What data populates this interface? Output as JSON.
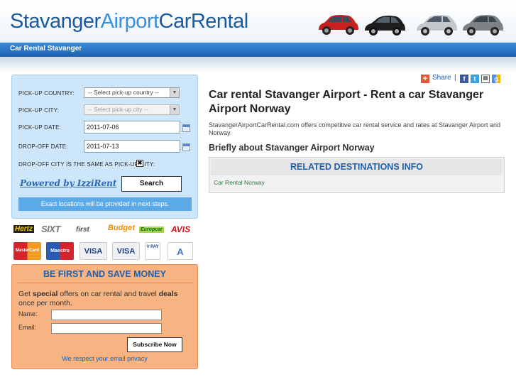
{
  "header": {
    "title_part1": "Stavanger",
    "title_part2": "Airport",
    "title_part3": "CarRental",
    "nav_link": "Car Rental Stavanger"
  },
  "search_form": {
    "pickup_country_label": "PICK-UP COUNTRY:",
    "pickup_country_value": "-- Select pick-up country --",
    "pickup_city_label": "PICK-UP CITY:",
    "pickup_city_value": "-- Select pick-up city --",
    "pickup_date_label": "PICK-UP DATE:",
    "pickup_date_value": "2011-07-06",
    "dropoff_date_label": "DROP-OFF DATE:",
    "dropoff_date_value": "2011-07-13",
    "same_city_label": "DROP-OFF CITY IS THE SAME AS PICK-UP CITY:",
    "same_city_checked": "✖",
    "powered_by": "Powered by IzziRent",
    "search_button": "Search",
    "exact_note": "Exact locations will be provided in next steps."
  },
  "partners": [
    "Hertz",
    "SIXT",
    "first",
    "Budget",
    "Europcar",
    "AVIS"
  ],
  "cards": [
    "MasterCard",
    "Maestro",
    "VISA",
    "VISA",
    "V PAY",
    "A"
  ],
  "newsletter": {
    "title": "BE FIRST AND SAVE MONEY",
    "text_1": "Get ",
    "text_2": "special",
    "text_3": " offers on car rental and travel ",
    "text_4": "deals",
    "text_5": " once per month.",
    "name_label": "Name:",
    "email_label": "Email:",
    "subscribe_button": "Subscribe Now",
    "privacy_link": "We respect your email privacy"
  },
  "share": {
    "label": "Share",
    "separator": "|"
  },
  "main": {
    "title": "Car rental Stavanger Airport - Rent a car Stavanger Airport Norway",
    "intro": "StavangerAirportCarRental.com offers competitive car rental service and rates at Stavanger Airport and Norway.",
    "about_heading": "Briefly about Stavanger Airport Norway",
    "related_heading": "RELATED DESTINATIONS INFO",
    "related_link": "Car Rental Norway"
  },
  "colors": {
    "brand_blue": "#1a5aa0",
    "nav_blue": "#2a72c2",
    "search_bg": "#cde6fa",
    "newsletter_bg": "#f8b382"
  }
}
